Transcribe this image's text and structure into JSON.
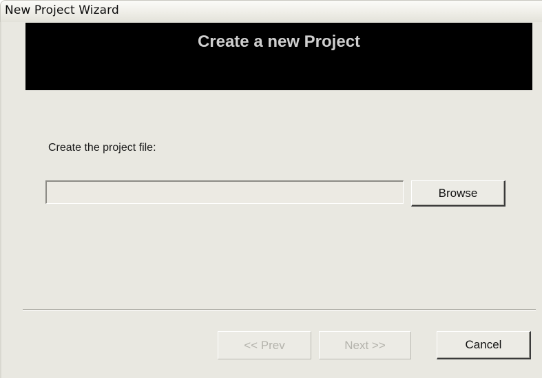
{
  "window": {
    "title": "New Project Wizard"
  },
  "banner": {
    "heading": "Create a new Project",
    "background_color": "#000000",
    "text_color": "#cfcfcf"
  },
  "form": {
    "prompt_label": "Create the project file:",
    "file_path": {
      "value": "",
      "placeholder": ""
    },
    "browse_label": "Browse"
  },
  "footer": {
    "prev_label": "<< Prev",
    "prev_enabled": false,
    "next_label": "Next >>",
    "next_enabled": false,
    "cancel_label": "Cancel",
    "cancel_enabled": true
  }
}
